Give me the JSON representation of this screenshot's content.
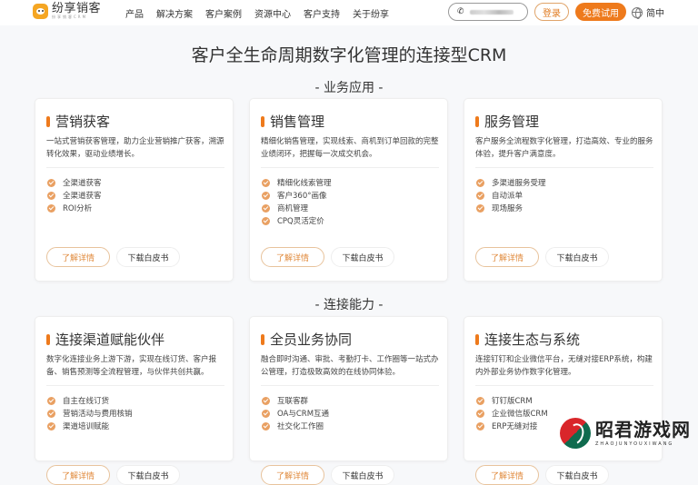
{
  "header": {
    "logo_name": "纷享销客",
    "logo_sub": "纷享销客CRM",
    "nav": [
      "产品",
      "解决方案",
      "客户案例",
      "资源中心",
      "客户支持",
      "关于纷享"
    ],
    "phone_icon": "phone-icon",
    "login_label": "登录",
    "trial_label": "免费试用",
    "lang_label": "简中"
  },
  "page_title": "客户全生命周期数字化管理的连接型CRM",
  "sections": [
    {
      "title": "- 业务应用 -",
      "cards": [
        {
          "title": "营销获客",
          "desc": "一站式营销获客管理，助力企业营销推广获客，溯源转化效果，驱动业绩增长。",
          "features": [
            "全渠道获客",
            "全渠道获客",
            "ROI分析"
          ],
          "detail_label": "了解详情",
          "download_label": "下载白皮书"
        },
        {
          "title": "销售管理",
          "desc": "精细化销售管理，实现线索、商机到订单回款的完整业绩闭环，把握每一次成交机会。",
          "features": [
            "精细化线索管理",
            "客户360°画像",
            "商机管理",
            "CPQ灵活定价"
          ],
          "detail_label": "了解详情",
          "download_label": "下载白皮书"
        },
        {
          "title": "服务管理",
          "desc": "客户服务全流程数字化管理，打造高效、专业的服务体验，提升客户满意度。",
          "features": [
            "多渠道服务受理",
            "自动派单",
            "现场服务"
          ],
          "detail_label": "了解详情",
          "download_label": "下载白皮书"
        }
      ]
    },
    {
      "title": "- 连接能力 -",
      "cards": [
        {
          "title": "连接渠道赋能伙伴",
          "desc": "数字化连接业务上游下游，实现在线订货、客户报备、销售预测等全流程管理，与伙伴共创共赢。",
          "features": [
            "自主在线订货",
            "营销活动与费用核销",
            "渠道培训赋能"
          ],
          "detail_label": "了解详情",
          "download_label": "下载白皮书"
        },
        {
          "title": "全员业务协同",
          "desc": "融合即时沟通、审批、考勤打卡、工作圈等一站式办公管理，打造极致高效的在线协同体验。",
          "features": [
            "互联客群",
            "OA与CRM互通",
            "社交化工作圈"
          ],
          "detail_label": "了解详情",
          "download_label": "下载白皮书"
        },
        {
          "title": "连接生态与系统",
          "desc": "连接钉钉和企业微信平台，无缝对接ERP系统，构建内外部业务协作数字化管理。",
          "features": [
            "钉钉版CRM",
            "企业微信版CRM",
            "ERP无缝对接"
          ],
          "detail_label": "了解详情",
          "download_label": "下载白皮书"
        }
      ]
    }
  ],
  "watermark": {
    "name": "昭君游戏网",
    "sub": "ZHAOJUNYOUXIWANG"
  },
  "colors": {
    "accent": "#ee7a1c",
    "check": "#e9a062",
    "detail_border": "#e8c39c"
  }
}
